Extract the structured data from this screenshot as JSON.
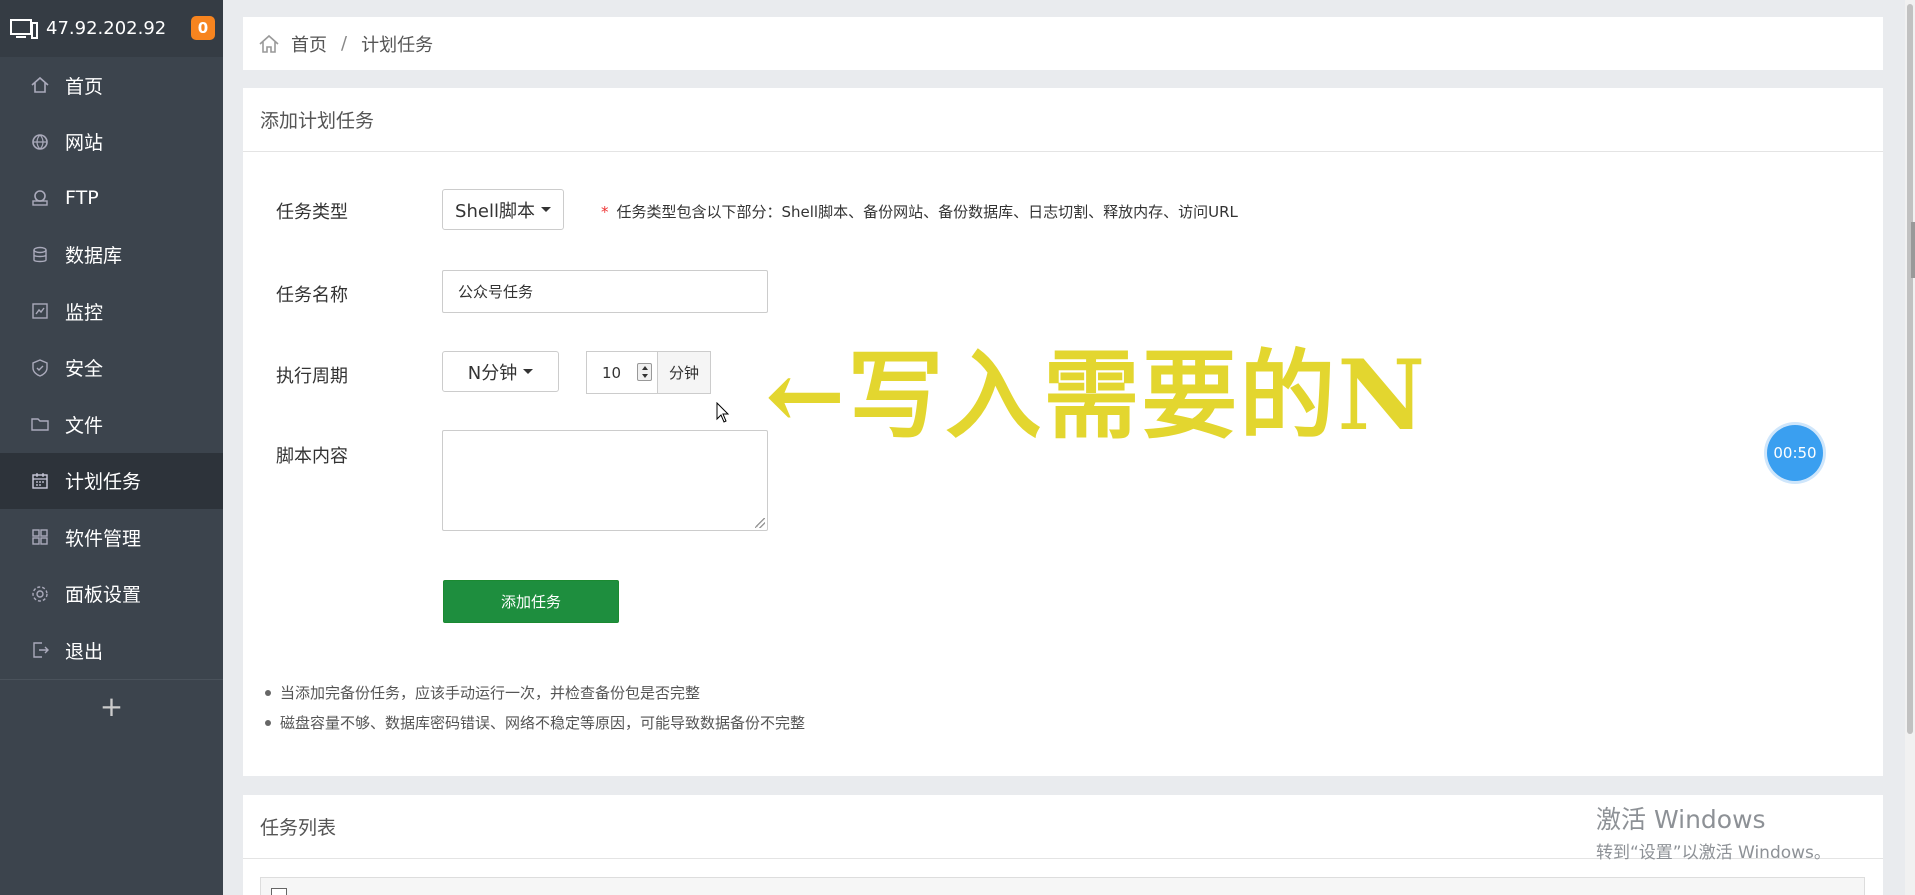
{
  "sidebar": {
    "host": "47.92.202.92",
    "badge": "0",
    "items": [
      {
        "label": "首页",
        "icon": "home-icon"
      },
      {
        "label": "网站",
        "icon": "globe-icon"
      },
      {
        "label": "FTP",
        "icon": "ftp-icon"
      },
      {
        "label": "数据库",
        "icon": "database-icon"
      },
      {
        "label": "监控",
        "icon": "monitor-icon"
      },
      {
        "label": "安全",
        "icon": "shield-icon"
      },
      {
        "label": "文件",
        "icon": "folder-icon"
      },
      {
        "label": "计划任务",
        "icon": "calendar-icon",
        "active": true
      },
      {
        "label": "软件管理",
        "icon": "apps-icon"
      },
      {
        "label": "面板设置",
        "icon": "gear-icon"
      },
      {
        "label": "退出",
        "icon": "logout-icon"
      }
    ],
    "add_label": "+"
  },
  "breadcrumb": {
    "home": "首页",
    "separator": "/",
    "current": "计划任务"
  },
  "form": {
    "title": "添加计划任务",
    "type_label": "任务类型",
    "type_value": "Shell脚本",
    "type_hint_star": "*",
    "type_hint": "任务类型包含以下部分：Shell脚本、备份网站、备份数据库、日志切割、释放内存、访问URL",
    "name_label": "任务名称",
    "name_value": "公众号任务",
    "period_label": "执行周期",
    "period_value": "N分钟",
    "minute_value": "10",
    "minute_unit": "分钟",
    "script_label": "脚本内容",
    "submit_label": "添加任务"
  },
  "notes": [
    "当添加完备份任务，应该手动运行一次，并检查备份包是否完整",
    "磁盘容量不够、数据库密码错误、网络不稳定等原因，可能导致数据备份不完整"
  ],
  "annotation": "←写入需要的N",
  "timer": "00:50",
  "task_list_title": "任务列表",
  "watermark": {
    "line1": "激活 Windows",
    "line2": "转到“设置”以激活 Windows。"
  },
  "colors": {
    "sidebar_bg": "#3c444d",
    "submit_bg": "#1e8e3e",
    "badge": "#f7841f",
    "annotation": "#e3d62f",
    "timer": "#3a9ff0"
  }
}
